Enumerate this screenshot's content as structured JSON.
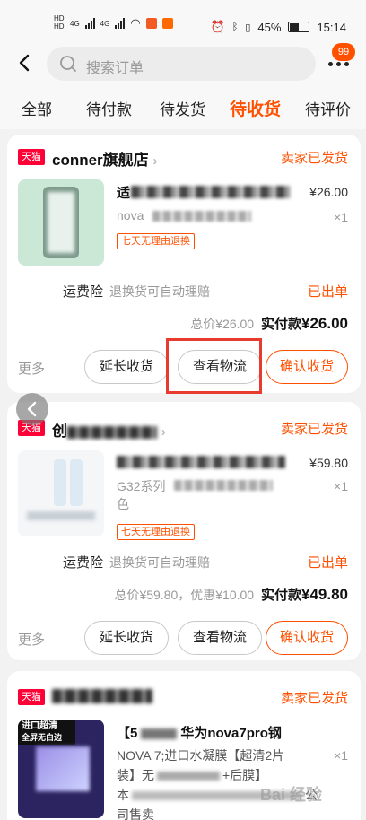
{
  "status_bar": {
    "hd1": "HD",
    "hd2": "HD",
    "net1": "4G",
    "net2": "4G",
    "battery": "45%",
    "time": "15:14"
  },
  "header": {
    "search_placeholder": "搜索订单",
    "badge": "99"
  },
  "tabs": [
    {
      "label": "全部"
    },
    {
      "label": "待付款"
    },
    {
      "label": "待发货"
    },
    {
      "label": "待收货",
      "active": true
    },
    {
      "label": "待评价"
    }
  ],
  "orders": [
    {
      "shop_tag": "天猫",
      "shop_name": "conner旗舰店",
      "status": "卖家已发货",
      "title_visible": "适",
      "sku_visible": "nova",
      "price": "¥26.00",
      "qty": "×1",
      "promise": "七天无理由退换",
      "freight_label": "运费险",
      "freight_desc": "退换货可自动理赔",
      "freight_status": "已出单",
      "total_label": "总价",
      "total": "¥26.00",
      "paid_label": "实付款",
      "paid": "¥26.00",
      "more": "更多",
      "btn_extend": "延长收货",
      "btn_logistics": "查看物流",
      "btn_confirm": "确认收货"
    },
    {
      "shop_tag": "天猫",
      "shop_name": "创",
      "status": "卖家已发货",
      "sku_visible": "G32系列",
      "sku_line2": "色",
      "price": "¥59.80",
      "qty": "×1",
      "promise": "七天无理由退换",
      "freight_label": "运费险",
      "freight_desc": "退换货可自动理赔",
      "freight_status": "已出单",
      "total_label": "总价",
      "total": "¥59.80",
      "discount_label": "优惠",
      "discount": "¥10.00",
      "paid_label": "实付款",
      "paid": "¥49.80",
      "more": "更多",
      "btn_extend": "延长收货",
      "btn_logistics": "查看物流",
      "btn_confirm": "确认收货"
    },
    {
      "shop_tag": "天猫",
      "status": "卖家已发货",
      "title_prefix": "【5",
      "title_mid": "华为nova7pro钢",
      "line2": "NOVA 7;进口水凝膜【超清2片",
      "line3_a": "装】无",
      "line3_b": "+后膜】",
      "line4_a": "本",
      "line4_b": "公",
      "line5": "司售卖",
      "thumb_text": "进口超清",
      "thumb_text2": "全屏无白边",
      "qty": "×1"
    }
  ],
  "watermark": "Bai 经验"
}
